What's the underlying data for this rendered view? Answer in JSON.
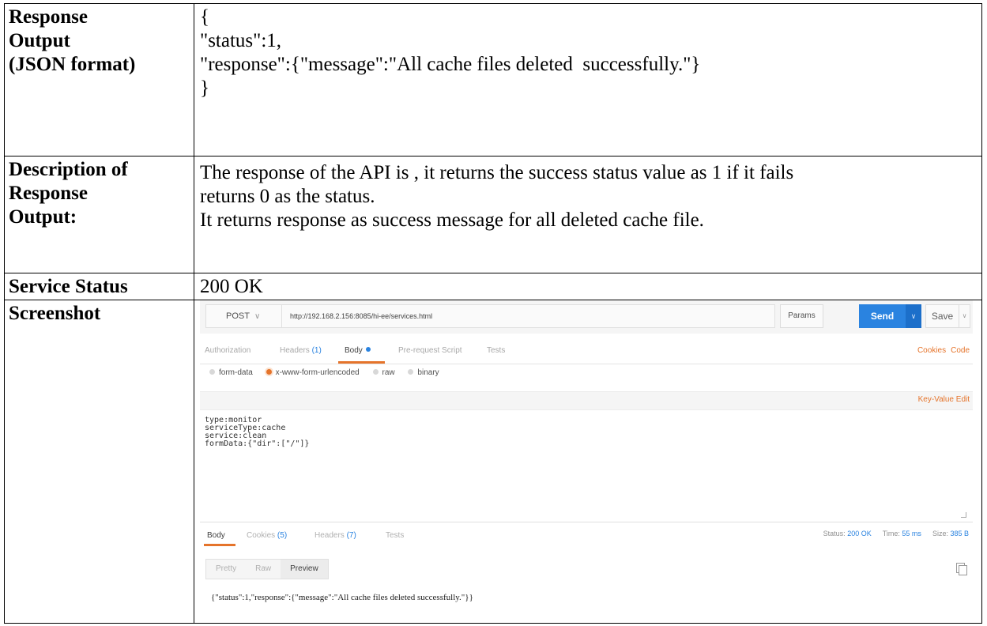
{
  "rows": {
    "response_output": {
      "label_lines": [
        "Response",
        "Output",
        "(JSON format)"
      ],
      "value_lines": [
        "{",
        "\"status\":1,",
        "\"response\":{\"message\":\"All cache files deleted  successfully.\"}",
        "}"
      ]
    },
    "description": {
      "label_lines": [
        "Description of",
        "Response",
        "Output:"
      ],
      "value_lines": [
        "The response of the API is , it returns the success status value as 1 if it fails",
        "returns 0 as the status.",
        "It returns response as success message for all deleted cache file."
      ]
    },
    "service_status": {
      "label": "Service Status",
      "value": "200 OK"
    },
    "screenshot": {
      "label": "Screenshot"
    }
  },
  "postman": {
    "method": "POST",
    "url": "http://192.168.2.156:8085/hi-ee/services.html",
    "params_label": "Params",
    "send_label": "Send",
    "save_label": "Save",
    "request_tabs": {
      "authorization": "Authorization",
      "headers": "Headers",
      "headers_count": "(1)",
      "body": "Body",
      "prerequest": "Pre-request Script",
      "tests": "Tests"
    },
    "cookies_link": "Cookies",
    "code_link": "Code",
    "body_modes": [
      "form-data",
      "x-www-form-urlencoded",
      "raw",
      "binary"
    ],
    "selected_mode": "x-www-form-urlencoded",
    "key_value_edit": "Key-Value Edit",
    "body_text": "type:monitor\nserviceType:cache\nservice:clean\nformData:{\"dir\":[\"/\"]}",
    "response_tabs": {
      "body": "Body",
      "cookies": "Cookies",
      "cookies_count": "(5)",
      "headers": "Headers",
      "headers_count": "(7)",
      "tests": "Tests"
    },
    "status_label": "Status:",
    "status_value": "200 OK",
    "time_label": "Time:",
    "time_value": "55 ms",
    "size_label": "Size:",
    "size_value": "385 B",
    "view_buttons": [
      "Pretty",
      "Raw",
      "Preview"
    ],
    "active_view": "Preview",
    "response_body": "{\"status\":1,\"response\":{\"message\":\"All cache files deleted successfully.\"}}"
  },
  "colors": {
    "accent_orange": "#e5742b",
    "accent_blue": "#2a83e0"
  }
}
